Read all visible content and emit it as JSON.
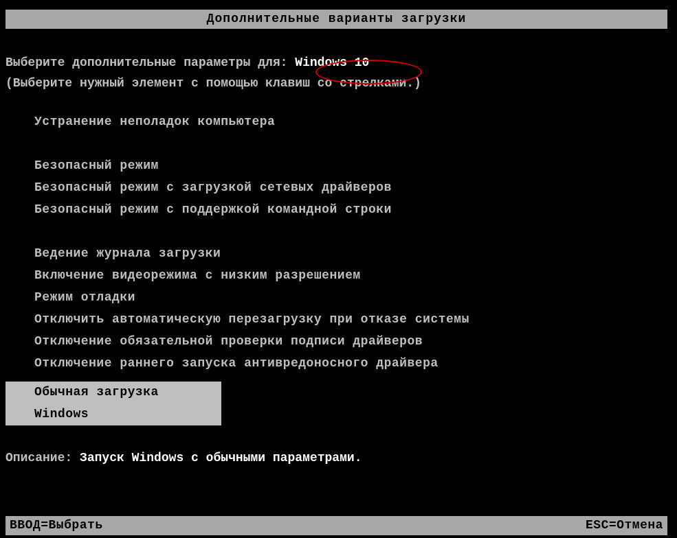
{
  "header": {
    "title": "Дополнительные варианты загрузки"
  },
  "prompt": {
    "prefix": "Выберите дополнительные параметры для: ",
    "os_name": "Windows 10"
  },
  "hint": "(Выберите нужный элемент с помощью клавиш со стрелками.)",
  "menu": {
    "items": [
      "Устранение неполадок компьютера",
      "Безопасный режим",
      "Безопасный режим с загрузкой сетевых драйверов",
      "Безопасный режим с поддержкой командной строки",
      "Ведение журнала загрузки",
      "Включение видеорежима с низким разрешением",
      "Режим отладки",
      "Отключить автоматическую перезагрузку при отказе системы",
      "Отключение обязательной проверки подписи драйверов",
      "Отключение раннего запуска антивредоносного драйвера",
      "Обычная загрузка Windows"
    ]
  },
  "description": {
    "label": "Описание: ",
    "text": "Запуск Windows с обычными параметрами."
  },
  "footer": {
    "left": "ВВОД=Выбрать",
    "right": "ESC=Отмена"
  }
}
